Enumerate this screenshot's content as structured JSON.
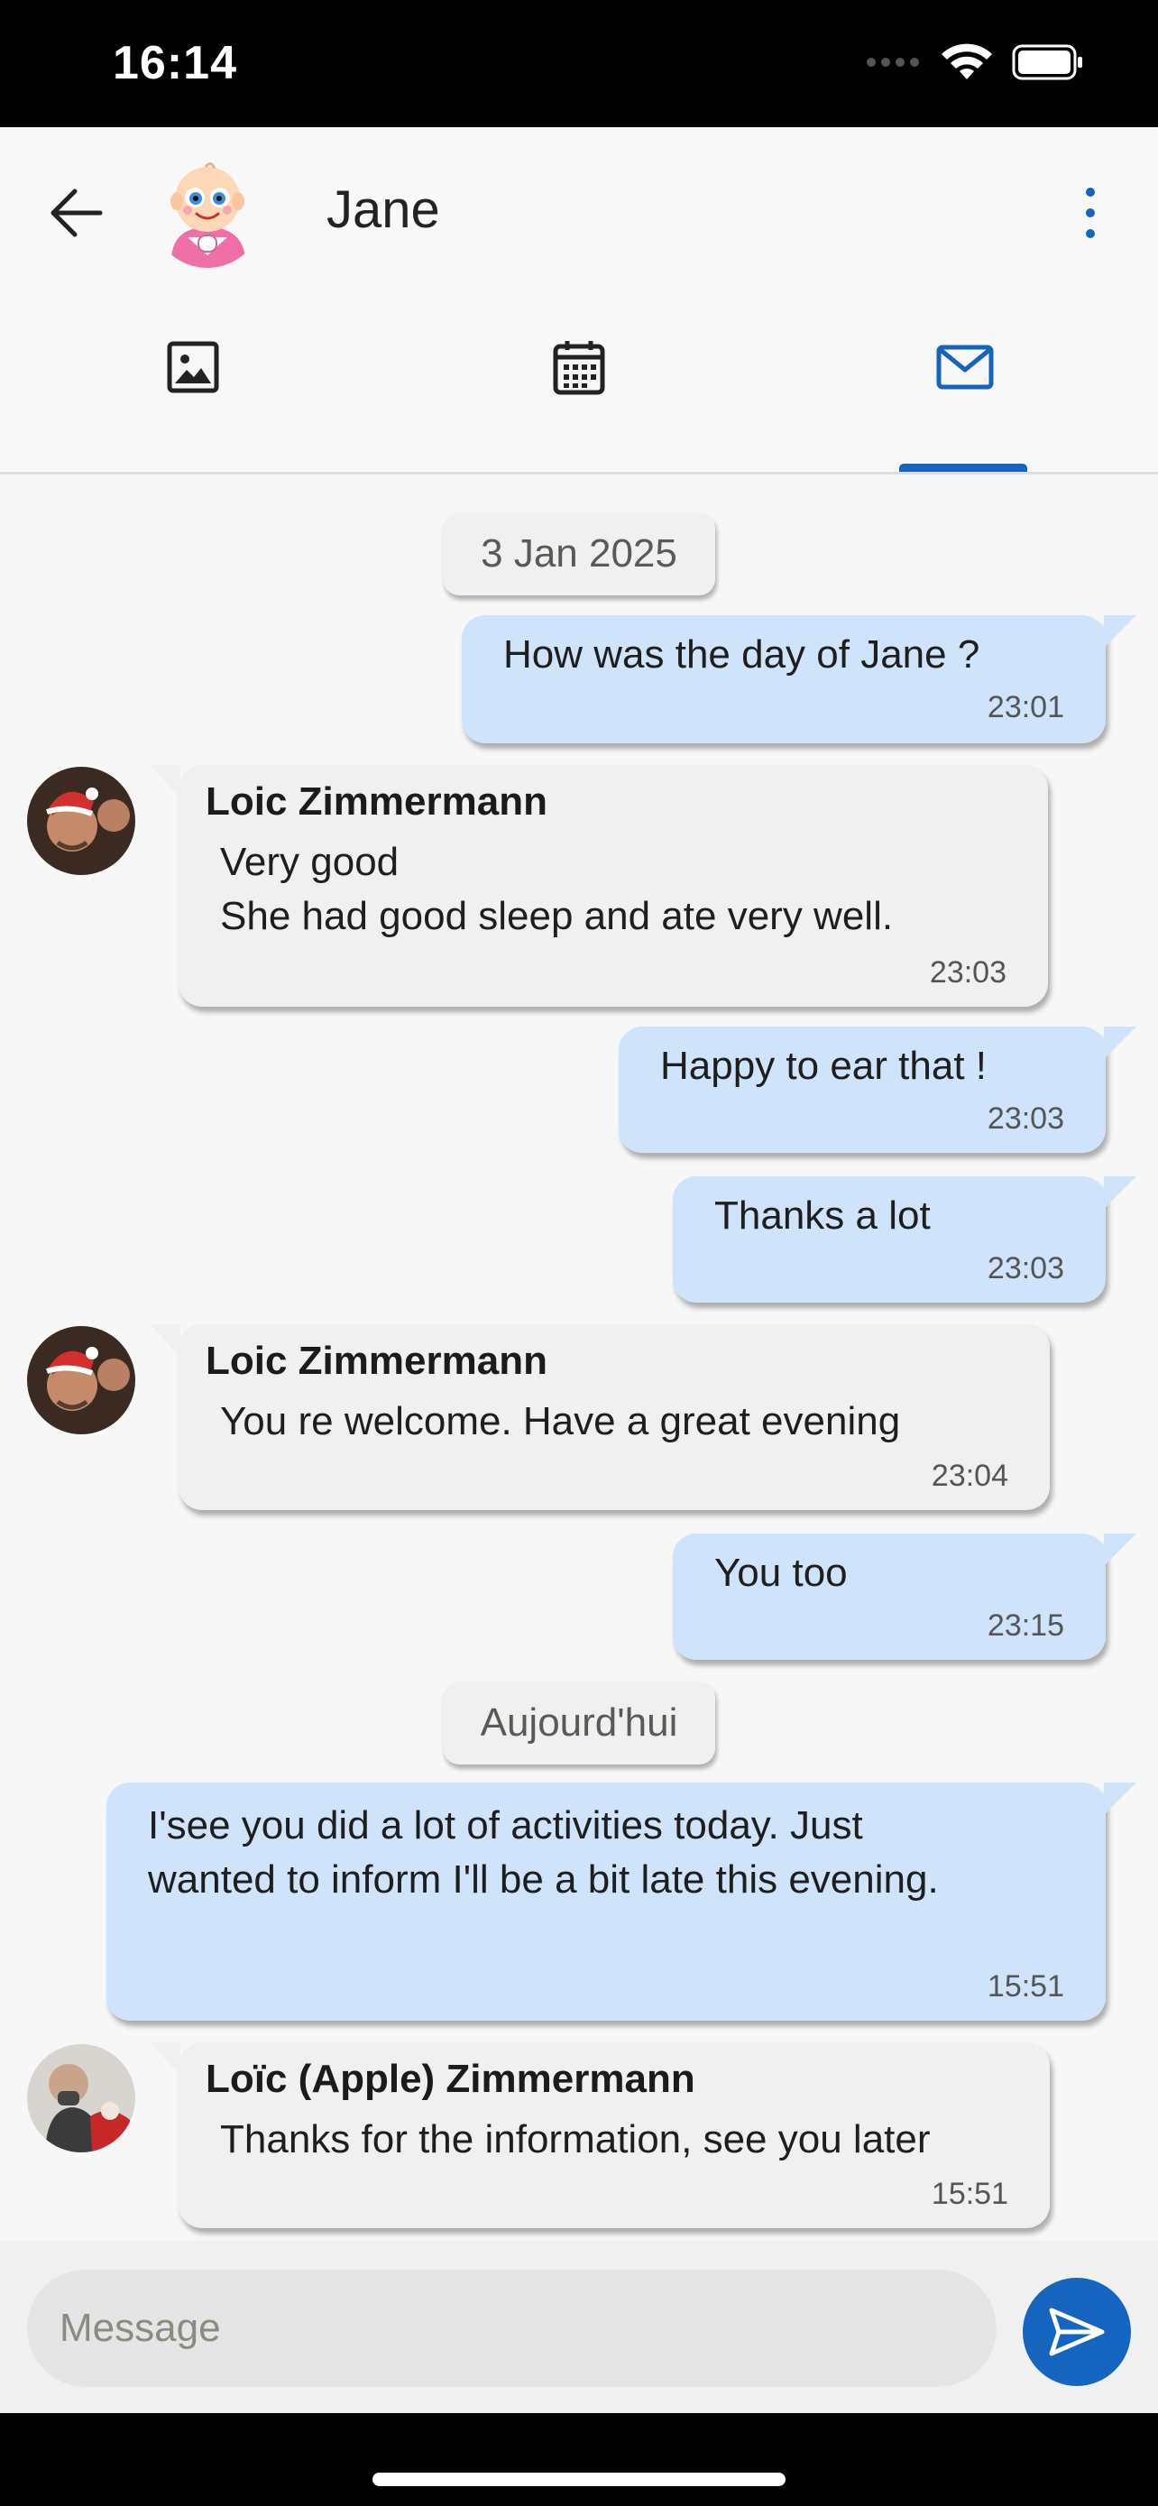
{
  "status_bar": {
    "time": "16:14",
    "icons": [
      "signal-icon",
      "wifi-icon",
      "battery-icon"
    ]
  },
  "header": {
    "contact_name": "Jane",
    "avatar": "baby-avatar",
    "tabs": [
      {
        "name": "photos",
        "icon": "image-icon",
        "active": false
      },
      {
        "name": "calendar",
        "icon": "calendar-icon",
        "active": false
      },
      {
        "name": "messages",
        "icon": "mail-icon",
        "active": true
      }
    ]
  },
  "colors": {
    "accent": "#1565c0",
    "outgoing_bubble": "#cfe4fb",
    "incoming_bubble": "#f0f0f0"
  },
  "messages": [
    {
      "type": "date",
      "text": "3 Jan 2025"
    },
    {
      "type": "out",
      "text": "How was the day of Jane ?",
      "time": "23:01"
    },
    {
      "type": "in",
      "sender": "Loic Zimmermann",
      "text": "Very good\nShe had good sleep and ate very well.",
      "time": "23:03"
    },
    {
      "type": "out",
      "text": "Happy to ear that !",
      "time": "23:03"
    },
    {
      "type": "out",
      "text": "Thanks a lot",
      "time": "23:03"
    },
    {
      "type": "in",
      "sender": "Loic Zimmermann",
      "text": "You re welcome. Have a great evening",
      "time": "23:04"
    },
    {
      "type": "out",
      "text": "You too",
      "time": "23:15"
    },
    {
      "type": "date",
      "text": "Aujourd'hui"
    },
    {
      "type": "out",
      "text": "I'see you did a lot of activities today. Just\nwanted to inform I'll be a bit late this evening.",
      "time": "15:51"
    },
    {
      "type": "in",
      "sender": "Loïc (Apple) Zimmermann",
      "text": "Thanks for the information, see you later",
      "time": "15:51"
    }
  ],
  "composer": {
    "placeholder": "Message"
  }
}
